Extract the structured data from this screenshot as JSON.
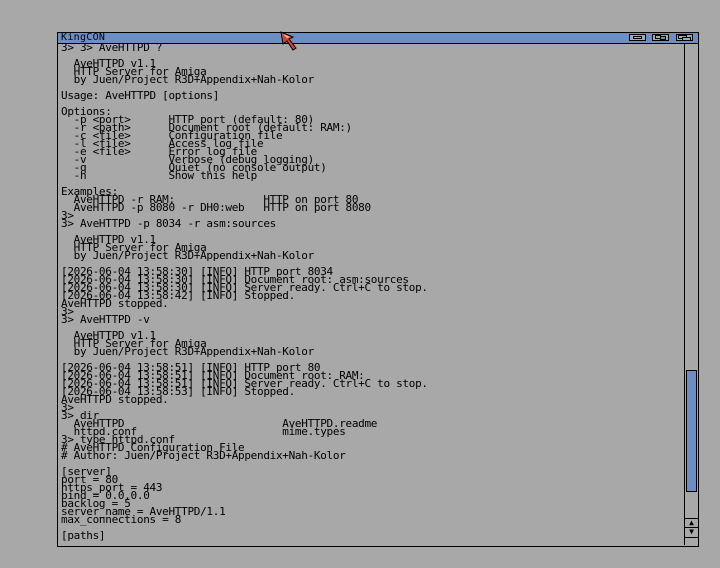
{
  "window": {
    "title": "KingCON"
  },
  "terminal": {
    "lines": [
      "3> 3> AveHTTPD ?",
      "",
      "  AveHTTPD v1.1",
      "  HTTP Server for Amiga",
      "  by Juen/Project R3D+Appendix+Nah-Kolor",
      "",
      "Usage: AveHTTPD [options]",
      "",
      "Options:",
      "  -p <port>      HTTP port (default: 80)",
      "  -r <path>      Document root (default: RAM:)",
      "  -c <file>      Configuration file",
      "  -l <file>      Access log file",
      "  -e <file>      Error log file",
      "  -v             Verbose (debug logging)",
      "  -q             Quiet (no console output)",
      "  -h             Show this help",
      "",
      "Examples:",
      "  AveHTTPD -r RAM:              HTTP on port 80",
      "  AveHTTPD -p 8080 -r DH0:web   HTTP on port 8080",
      "3>",
      "3> AveHTTPD -p 8034 -r asm:sources",
      "",
      "  AveHTTPD v1.1",
      "  HTTP Server for Amiga",
      "  by Juen/Project R3D+Appendix+Nah-Kolor",
      "",
      "[2026-06-04 13:58:30] [INFO] HTTP port 8034",
      "[2026-06-04 13:58:30] [INFO] Document root: asm:sources",
      "[2026-06-04 13:58:30] [INFO] Server ready. Ctrl+C to stop.",
      "[2026-06-04 13:58:42] [INFO] Stopped.",
      "AveHTTPD stopped.",
      "3>",
      "3> AveHTTPD -v",
      "",
      "  AveHTTPD v1.1",
      "  HTTP Server for Amiga",
      "  by Juen/Project R3D+Appendix+Nah-Kolor",
      "",
      "[2026-06-04 13:58:51] [INFO] HTTP port 80",
      "[2026-06-04 13:58:51] [INFO] Document root: RAM:",
      "[2026-06-04 13:58:51] [INFO] Server ready. Ctrl+C to stop.",
      "[2026-06-04 13:58:53] [INFO] Stopped.",
      "AveHTTPD stopped.",
      "3>",
      "3> dir",
      "  AveHTTPD                         AveHTTPD.readme",
      "  httpd.conf                       mime.types",
      "3> type httpd.conf",
      "# AveHTTPD Configuration File",
      "# Author: Juen/Project R3D+Appendix+Nah-Kolor",
      "",
      "[server]",
      "port = 80",
      "https_port = 443",
      "bind = 0.0.0.0",
      "backlog = 5",
      "server_name = AveHTTPD/1.1",
      "max_connections = 8",
      "",
      "[paths]"
    ]
  },
  "scrollbar": {
    "up_arrow": "▲",
    "down_arrow": "▼"
  }
}
